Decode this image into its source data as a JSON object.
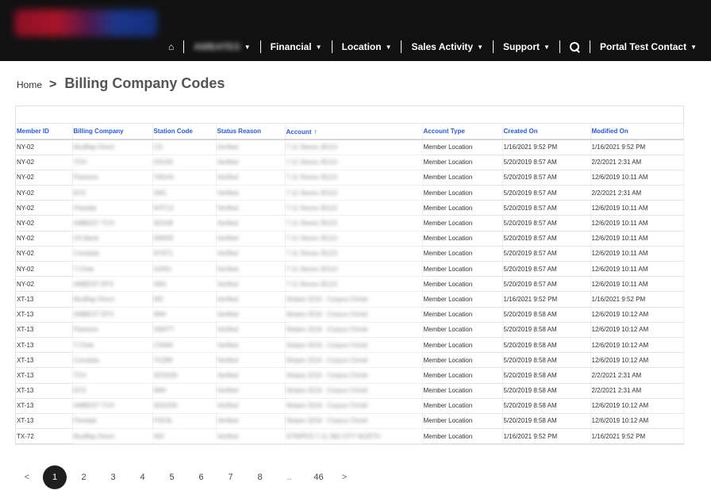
{
  "nav": {
    "hidden_item": "Home",
    "blurred_item": "AMBATES",
    "items": [
      "Financial",
      "Location",
      "Sales Activity",
      "Support"
    ],
    "contact": "Portal Test Contact",
    "search_icon": "search-icon"
  },
  "breadcrumb": {
    "home": "Home",
    "separator": ">",
    "title": "Billing Company Codes"
  },
  "table": {
    "columns": [
      "Member ID",
      "Billing Company",
      "Station Code",
      "Status Reason",
      "Account",
      "Account Type",
      "Created On",
      "Modified On"
    ],
    "sort_indicator": "↑",
    "rows": [
      [
        "NY-02",
        "Mudflap Direct",
        "CD",
        "Verified",
        "7-11 Stores 35115",
        "Member Location",
        "1/16/2021 9:52 PM",
        "1/16/2021 9:52 PM"
      ],
      [
        "NY-02",
        "TCH",
        "DS106",
        "Verified",
        "7-11 Stores 35115",
        "Member Location",
        "5/20/2019 8:57 AM",
        "2/2/2021 2:31 AM"
      ],
      [
        "NY-02",
        "Fleetone",
        "YM143",
        "Verified",
        "7-11 Stores 35115",
        "Member Location",
        "5/20/2019 8:57 AM",
        "12/6/2019 10:11 AM"
      ],
      [
        "NY-02",
        "EFS",
        "SM1",
        "Verified",
        "7-11 Stores 35115",
        "Member Location",
        "5/20/2019 8:57 AM",
        "2/2/2021 2:31 AM"
      ],
      [
        "NY-02",
        "Fleetdat",
        "NYF13",
        "Verified",
        "7-11 Stores 35115",
        "Member Location",
        "5/20/2019 8:57 AM",
        "12/6/2019 10:11 AM"
      ],
      [
        "NY-02",
        "AMBEST TCH",
        "SD106",
        "Verified",
        "7-11 Stores 35115",
        "Member Location",
        "5/20/2019 8:57 AM",
        "12/6/2019 10:11 AM"
      ],
      [
        "NY-02",
        "US Bank",
        "NN005",
        "Verified",
        "7-11 Stores 35115",
        "Member Location",
        "5/20/2019 8:57 AM",
        "12/6/2019 10:11 AM"
      ],
      [
        "NY-02",
        "Comdata",
        "NY871",
        "Verified",
        "7-11 Stores 35115",
        "Member Location",
        "5/20/2019 8:57 AM",
        "12/6/2019 10:11 AM"
      ],
      [
        "NY-02",
        "T-Chek",
        "S2051",
        "Verified",
        "7-11 Stores 35115",
        "Member Location",
        "5/20/2019 8:57 AM",
        "12/6/2019 10:11 AM"
      ],
      [
        "NY-02",
        "AMBEST EFS",
        "SM1",
        "Verified",
        "7-11 Stores 35115",
        "Member Location",
        "5/20/2019 8:57 AM",
        "12/6/2019 10:11 AM"
      ],
      [
        "XT-13",
        "Mudflap Direct",
        "MD",
        "Verified",
        "Stripes 3216 - Corpus Christi",
        "Member Location",
        "1/16/2021 9:52 PM",
        "1/16/2021 9:52 PM"
      ],
      [
        "XT-13",
        "AMBEST EFS",
        "9M4",
        "Verified",
        "Stripes 3216 - Corpus Christi",
        "Member Location",
        "5/20/2019 8:58 AM",
        "12/6/2019 10:12 AM"
      ],
      [
        "XT-13",
        "Fleetone",
        "SM4TT",
        "Verified",
        "Stripes 3216 - Corpus Christi",
        "Member Location",
        "5/20/2019 8:58 AM",
        "12/6/2019 10:12 AM"
      ],
      [
        "XT-13",
        "T-Chek",
        "CS584",
        "Verified",
        "Stripes 3216 - Corpus Christi",
        "Member Location",
        "5/20/2019 8:58 AM",
        "12/6/2019 10:12 AM"
      ],
      [
        "XT-13",
        "Comdata",
        "TX288",
        "Verified",
        "Stripes 3216 - Corpus Christi",
        "Member Location",
        "5/20/2019 8:58 AM",
        "12/6/2019 10:12 AM"
      ],
      [
        "XT-13",
        "TCH",
        "SDS206",
        "Verified",
        "Stripes 3216 - Corpus Christi",
        "Member Location",
        "5/20/2019 8:58 AM",
        "2/2/2021 2:31 AM"
      ],
      [
        "XT-13",
        "EFS",
        "9M4",
        "Verified",
        "Stripes 3216 - Corpus Christi",
        "Member Location",
        "5/20/2019 8:58 AM",
        "2/2/2021 2:31 AM"
      ],
      [
        "XT-13",
        "AMBEST TCH",
        "SDS206",
        "Verified",
        "Stripes 3216 - Corpus Christi",
        "Member Location",
        "5/20/2019 8:58 AM",
        "12/6/2019 10:12 AM"
      ],
      [
        "XT-13",
        "Fleetdat",
        "FXE3L",
        "Verified",
        "Stripes 3216 - Corpus Christi",
        "Member Location",
        "5/20/2019 8:58 AM",
        "12/6/2019 10:12 AM"
      ],
      [
        "TX-72",
        "Mudflap Direct",
        "ADI",
        "Verified",
        "STRIPES-7-11 360 CITY NORTH",
        "Member Location",
        "1/16/2021 9:52 PM",
        "1/16/2021 9:52 PM"
      ]
    ]
  },
  "pagination": {
    "prev": "<",
    "current": "1",
    "pages": [
      "2",
      "3",
      "4",
      "5",
      "6",
      "7",
      "8"
    ],
    "ellipsis": "..",
    "last": "46",
    "next": ">"
  },
  "colors": {
    "topbar": "#111111",
    "link_blue": "#2a5cd0",
    "active_page": "#1e1e1e"
  }
}
